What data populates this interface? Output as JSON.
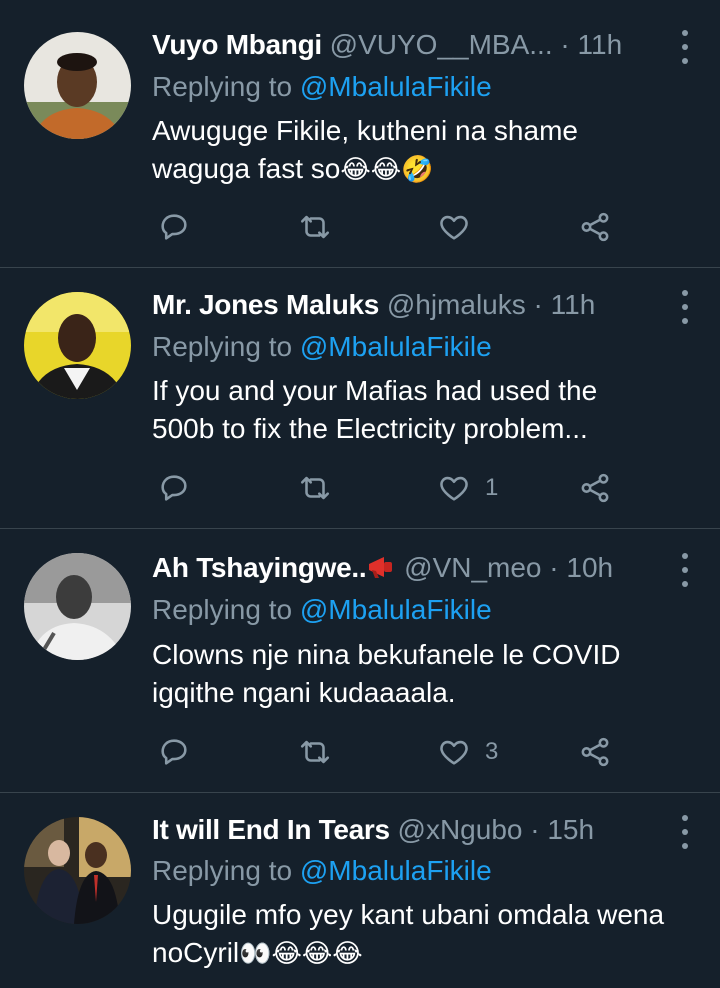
{
  "colors": {
    "background": "#15202b",
    "divider": "#38444d",
    "muted": "#8899a6",
    "mention": "#1da1f2",
    "text": "#ffffff"
  },
  "tweets": [
    {
      "name": "Vuyo Mbangi",
      "handle": "@VUYO__MBA...",
      "separator": "·",
      "time": "11h",
      "reply_prefix": "Replying to",
      "reply_to": "@MbalulaFikile",
      "text_lines": [
        "Awuguge Fikile, kutheni na shame",
        "waguga fast so"
      ],
      "emoji": "😂😂🤣",
      "likes": "",
      "avatar_icon": "user-avatar-photo"
    },
    {
      "name": "Mr. Jones Maluks",
      "handle": "@hjmaluks",
      "separator": "·",
      "time": "11h",
      "reply_prefix": "Replying to",
      "reply_to": "@MbalulaFikile",
      "text_lines": [
        "If you and your Mafias had used the",
        "500b to fix the Electricity problem..."
      ],
      "emoji": "",
      "likes": "1",
      "avatar_icon": "user-avatar-photo"
    },
    {
      "name": "Ah Tshayingwe..",
      "handle": "@VN_meo",
      "separator": "·",
      "time": "10h",
      "reply_prefix": "Replying to",
      "reply_to": "@MbalulaFikile",
      "text_lines": [
        "Clowns nje nina bekufanele le COVID",
        "igqithe ngani kudaaaala."
      ],
      "emoji": "",
      "likes": "3",
      "avatar_icon": "user-avatar-photo",
      "name_icon": "megaphone-icon"
    },
    {
      "name": "It will End In Tears",
      "handle": "@xNgubo",
      "separator": "·",
      "time": "15h",
      "reply_prefix": "Replying to",
      "reply_to": "@MbalulaFikile",
      "text_lines": [
        "Ugugile mfo yey kant ubani omdala wena",
        "noCyril"
      ],
      "emoji": "👀😂😂😂",
      "likes": "",
      "avatar_icon": "user-avatar-photo"
    }
  ]
}
